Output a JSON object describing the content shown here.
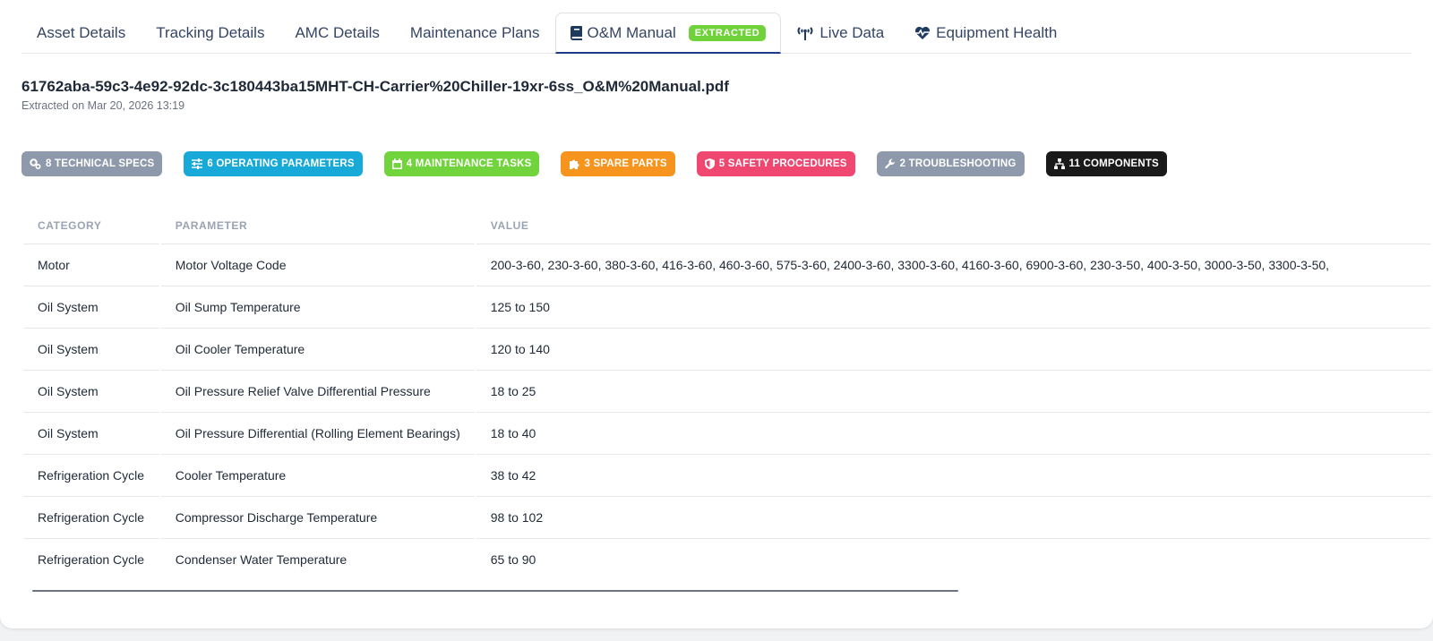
{
  "tabs": [
    {
      "label": "Asset Details"
    },
    {
      "label": "Tracking Details"
    },
    {
      "label": "AMC Details"
    },
    {
      "label": "Maintenance Plans"
    },
    {
      "label": "O&M Manual",
      "badge": "EXTRACTED",
      "icon": "book-icon"
    },
    {
      "label": "Live Data",
      "icon": "broadcast-icon"
    },
    {
      "label": "Equipment Health",
      "icon": "heartbeat-icon"
    }
  ],
  "document": {
    "filename": "61762aba-59c3-4e92-92dc-3c180443ba15MHT-CH-Carrier%20Chiller-19xr-6ss_O&M%20Manual.pdf",
    "extracted_on": "Extracted on Mar 20, 2026 13:19"
  },
  "chips": [
    {
      "label": "8 TECHNICAL SPECS",
      "color": "#8e9aab",
      "icon": "cogs-icon"
    },
    {
      "label": "6 OPERATING PARAMETERS",
      "color": "#17a9d8",
      "icon": "sliders-icon"
    },
    {
      "label": "4 MAINTENANCE TASKS",
      "color": "#72d43d",
      "icon": "calendar-icon"
    },
    {
      "label": "3 SPARE PARTS",
      "color": "#f7941d",
      "icon": "puzzle-icon"
    },
    {
      "label": "5 SAFETY PROCEDURES",
      "color": "#ef476f",
      "icon": "shield-icon"
    },
    {
      "label": "2 TROUBLESHOOTING",
      "color": "#8e9aab",
      "icon": "wrench-icon"
    },
    {
      "label": "11 COMPONENTS",
      "color": "#1a1a1a",
      "icon": "sitemap-icon"
    }
  ],
  "table": {
    "headers": [
      "CATEGORY",
      "PARAMETER",
      "VALUE"
    ],
    "rows": [
      [
        "Motor",
        "Motor Voltage Code",
        "200-3-60, 230-3-60, 380-3-60, 416-3-60, 460-3-60, 575-3-60, 2400-3-60, 3300-3-60, 4160-3-60, 6900-3-60, 230-3-50, 400-3-50, 3000-3-50, 3300-3-50,"
      ],
      [
        "Oil System",
        "Oil Sump Temperature",
        "125 to 150"
      ],
      [
        "Oil System",
        "Oil Cooler Temperature",
        "120 to 140"
      ],
      [
        "Oil System",
        "Oil Pressure Relief Valve Differential Pressure",
        "18 to 25"
      ],
      [
        "Oil System",
        "Oil Pressure Differential (Rolling Element Bearings)",
        "18 to 40"
      ],
      [
        "Refrigeration Cycle",
        "Cooler Temperature",
        "38 to 42"
      ],
      [
        "Refrigeration Cycle",
        "Compressor Discharge Temperature",
        "98 to 102"
      ],
      [
        "Refrigeration Cycle",
        "Condenser Water Temperature",
        "65 to 90"
      ]
    ]
  },
  "colors": {
    "active_tab_underline": "#1e3a8a",
    "extracted_badge": "#6fd23a"
  }
}
